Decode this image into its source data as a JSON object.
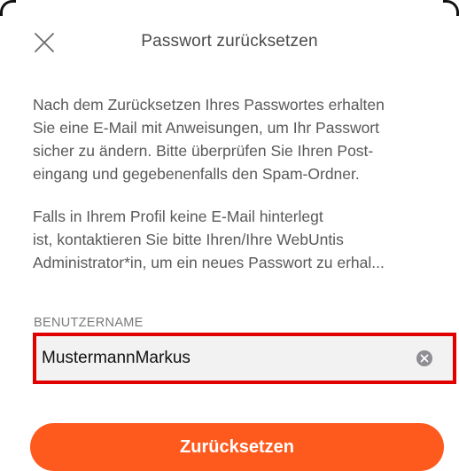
{
  "dialog": {
    "title": "Passwort zurücksetzen",
    "close_icon": "close-icon"
  },
  "instructions": {
    "paragraph_1": "Nach dem Zurücksetzen Ihres Passwortes erhalten\nSie eine E-Mail mit Anweisungen, um Ihr Passwort\nsicher zu ändern. Bitte überprüfen Sie Ihren Post-\neingang und gegebenenfalls den Spam-Ordner.",
    "paragraph_2": "Falls in Ihrem Profil keine E-Mail hinterlegt\nist, kontaktieren Sie bitte Ihren/Ihre WebUntis\nAdministrator*in, um ein neues Passwort zu erhal..."
  },
  "username_field": {
    "label": "BENUTZERNAME",
    "value": "MustermannMarkus",
    "clear_icon": "clear-circle-icon"
  },
  "actions": {
    "reset_label": "Zurücksetzen"
  },
  "colors": {
    "accent": "#ff5a1e",
    "highlight_border": "#e00000",
    "field_background": "#f2f2f2",
    "text": "#595959"
  }
}
